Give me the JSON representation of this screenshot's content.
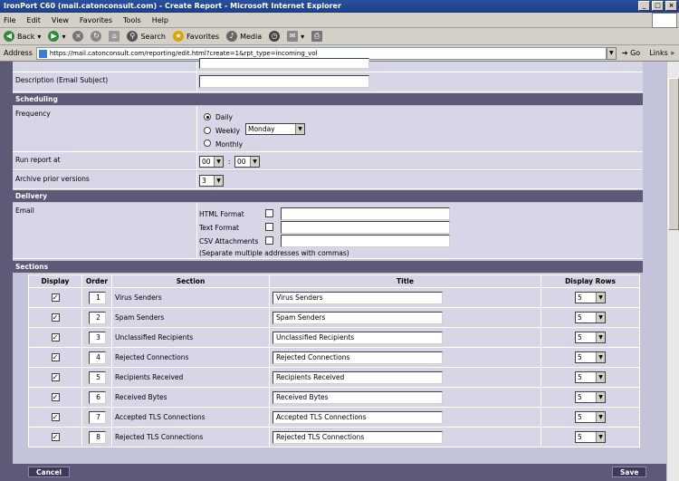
{
  "window": {
    "title": "IronPort C60 (mail.catonconsult.com) - Create Report - Microsoft Internet Explorer"
  },
  "menu": [
    "File",
    "Edit",
    "View",
    "Favorites",
    "Tools",
    "Help"
  ],
  "toolbar": {
    "back": "Back",
    "search": "Search",
    "favorites": "Favorites",
    "media": "Media"
  },
  "address": {
    "label": "Address",
    "url": "https://mail.catonconsult.com/reporting/edit.html?create=1&rpt_type=incoming_vol",
    "go": "Go",
    "links": "Links"
  },
  "form": {
    "description_label": "Description (Email Subject)",
    "description_value": "",
    "scheduling_header": "Scheduling",
    "frequency_label": "Frequency",
    "frequency_options": [
      "Daily",
      "Weekly",
      "Monthly"
    ],
    "frequency_selected": "Daily",
    "weekday_value": "Monday",
    "run_report_label": "Run report at",
    "run_hour": "00",
    "run_sep": ":",
    "run_minute": "00",
    "archive_label": "Archive prior versions",
    "archive_value": "3",
    "delivery_header": "Delivery",
    "email_label": "Email",
    "html_format": "HTML Format",
    "text_format": "Text Format",
    "csv_attachments": "CSV Attachments",
    "email_note": "(Separate multiple addresses with commas)",
    "sections_header": "Sections"
  },
  "sections_table": {
    "headers": [
      "Display",
      "Order",
      "Section",
      "Title",
      "Display Rows"
    ],
    "rows": [
      {
        "display": "✓",
        "order": "1",
        "section": "Virus Senders",
        "title": "Virus Senders",
        "rows": "5"
      },
      {
        "display": "✓",
        "order": "2",
        "section": "Spam Senders",
        "title": "Spam Senders",
        "rows": "5"
      },
      {
        "display": "✓",
        "order": "3",
        "section": "Unclassified Recipients",
        "title": "Unclassified Recipients",
        "rows": "5"
      },
      {
        "display": "✓",
        "order": "4",
        "section": "Rejected Connections",
        "title": "Rejected Connections",
        "rows": "5"
      },
      {
        "display": "✓",
        "order": "5",
        "section": "Recipients Received",
        "title": "Recipients Received",
        "rows": "5"
      },
      {
        "display": "✓",
        "order": "6",
        "section": "Received Bytes",
        "title": "Received Bytes",
        "rows": "5"
      },
      {
        "display": "✓",
        "order": "7",
        "section": "Accepted TLS Connections",
        "title": "Accepted TLS Connections",
        "rows": "5"
      },
      {
        "display": "✓",
        "order": "8",
        "section": "Rejected TLS Connections",
        "title": "Rejected TLS Connections",
        "rows": "5"
      }
    ]
  },
  "buttons": {
    "cancel": "Cancel",
    "save": "Save"
  }
}
